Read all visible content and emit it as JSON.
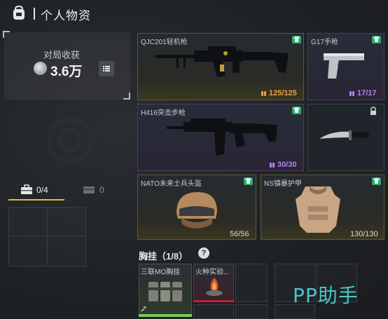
{
  "header": {
    "title": "个人物资"
  },
  "income": {
    "label": "对局收获",
    "value": "3.6万"
  },
  "weapons": {
    "primary1": {
      "name": "QJC201轻机枪",
      "ammo": "125/125"
    },
    "pistol": {
      "name": "G17手枪",
      "ammo": "17/17"
    },
    "primary2": {
      "name": "H416突击步枪",
      "ammo": "30/30"
    }
  },
  "armor": {
    "helmet": {
      "name": "NATO未来士兵头盔",
      "durability": "56/56"
    },
    "vest": {
      "name": "NS镇暴护甲",
      "durability": "130/130"
    }
  },
  "tabs": [
    {
      "label": "0/4"
    },
    {
      "label": "0"
    }
  ],
  "chest_rig": {
    "title": "胸挂（1/8）",
    "items": [
      {
        "name": "三联MO胸挂"
      },
      {
        "name": "火种实验..."
      }
    ]
  },
  "watermark": "PP助手",
  "colors": {
    "accent_gold": "#e2b84a",
    "tag_green": "#2fa76a",
    "ammo_orange": "#e7a045",
    "ammo_purple": "#b783e8",
    "rare_red": "#c0213a"
  }
}
